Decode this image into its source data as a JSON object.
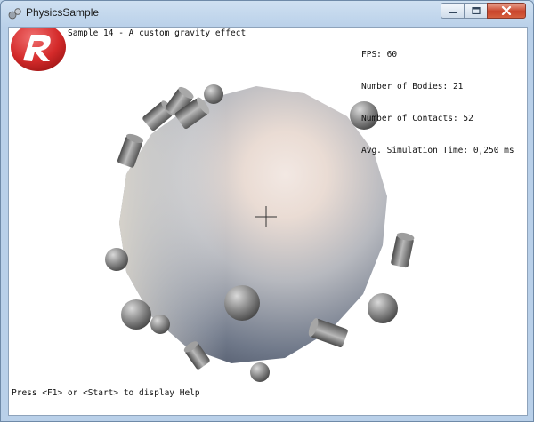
{
  "window": {
    "title": "PhysicsSample",
    "icons": {
      "app": "physics-sample-icon",
      "minimize": "minimize-icon",
      "maximize": "maximize-icon",
      "close": "close-icon"
    }
  },
  "hud": {
    "sample_title": "Sample 14 - A custom gravity effect",
    "stats": [
      "FPS: 60",
      "Number of Bodies: 21",
      "Number of Contacts: 52",
      "Avg. Simulation Time: 0,250 ms"
    ],
    "help_hint": "Press <F1> or <Start> to display Help"
  },
  "logo": {
    "icon": "logo-icon",
    "color": "#d42a2a"
  },
  "scene": {
    "crosshair": "crosshair-icon",
    "planet_color": "#c9c6c2"
  }
}
